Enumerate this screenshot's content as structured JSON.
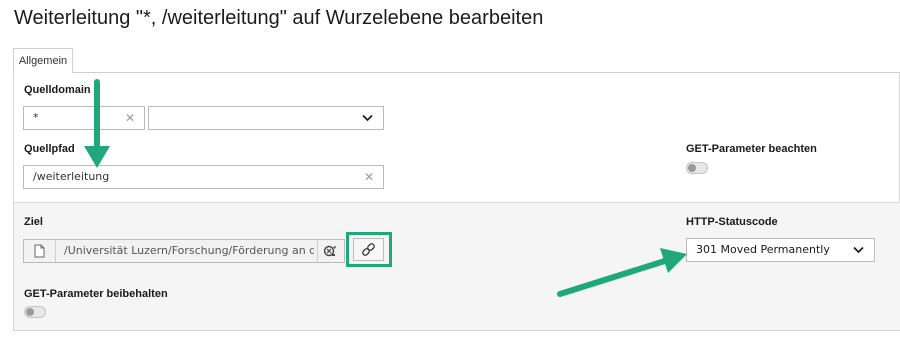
{
  "header": {
    "title": "Weiterleitung \"*, /weiterleitung\" auf Wurzelebene bearbeiten"
  },
  "tabs": [
    {
      "label": "Allgemein",
      "active": true
    }
  ],
  "form": {
    "source_domain": {
      "label": "Quelldomain",
      "value": "*",
      "select_value": ""
    },
    "source_path": {
      "label": "Quellpfad",
      "value": "/weiterleitung"
    },
    "respect_get_params": {
      "label": "GET-Parameter beachten",
      "checked": false
    },
    "target": {
      "label": "Ziel",
      "value": "/Universität Luzern/Forschung/Förderung an der Univ"
    },
    "http_status": {
      "label": "HTTP-Statuscode",
      "value": "301 Moved Permanently"
    },
    "keep_get_params": {
      "label": "GET-Parameter beibehalten",
      "checked": false
    }
  },
  "icons": {
    "clear": "close-icon",
    "dropdown": "chevron-down-icon",
    "page": "page-icon",
    "browse": "link-browser-icon",
    "link": "link-icon"
  },
  "colors": {
    "accent_arrow": "#20a77a",
    "highlight_border": "#20a77a"
  }
}
